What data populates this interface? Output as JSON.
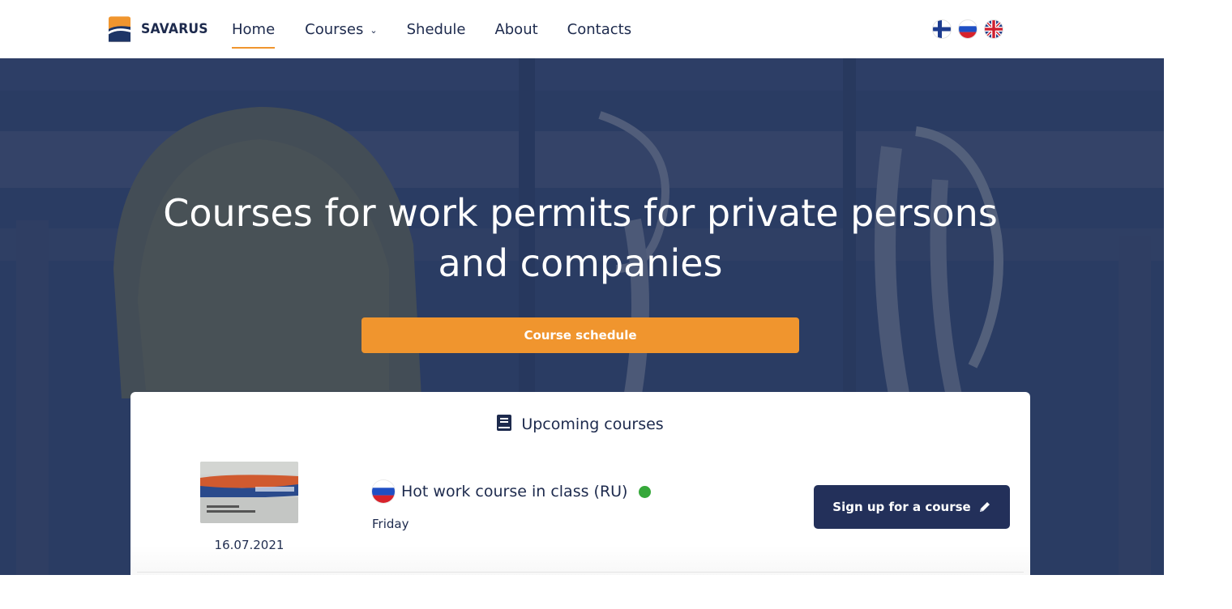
{
  "header": {
    "logo_text": "SAVARUS",
    "nav": [
      {
        "label": "Home",
        "active": true
      },
      {
        "label": "Courses",
        "has_dropdown": true
      },
      {
        "label": "Shedule"
      },
      {
        "label": "About"
      },
      {
        "label": "Contacts"
      }
    ],
    "languages": [
      "fi",
      "ru",
      "en"
    ]
  },
  "hero": {
    "title": "Courses for work permits for private persons and companies",
    "cta_label": "Course schedule"
  },
  "upcoming": {
    "heading": "Upcoming courses",
    "courses": [
      {
        "date": "16.07.2021",
        "title": "Hot work course in class (RU)",
        "day": "Friday",
        "status_color": "#36a83a",
        "signup_label": "Sign up for a course"
      }
    ]
  },
  "colors": {
    "accent": "#f0952e",
    "navy": "#23305a",
    "status": "#36a83a"
  }
}
